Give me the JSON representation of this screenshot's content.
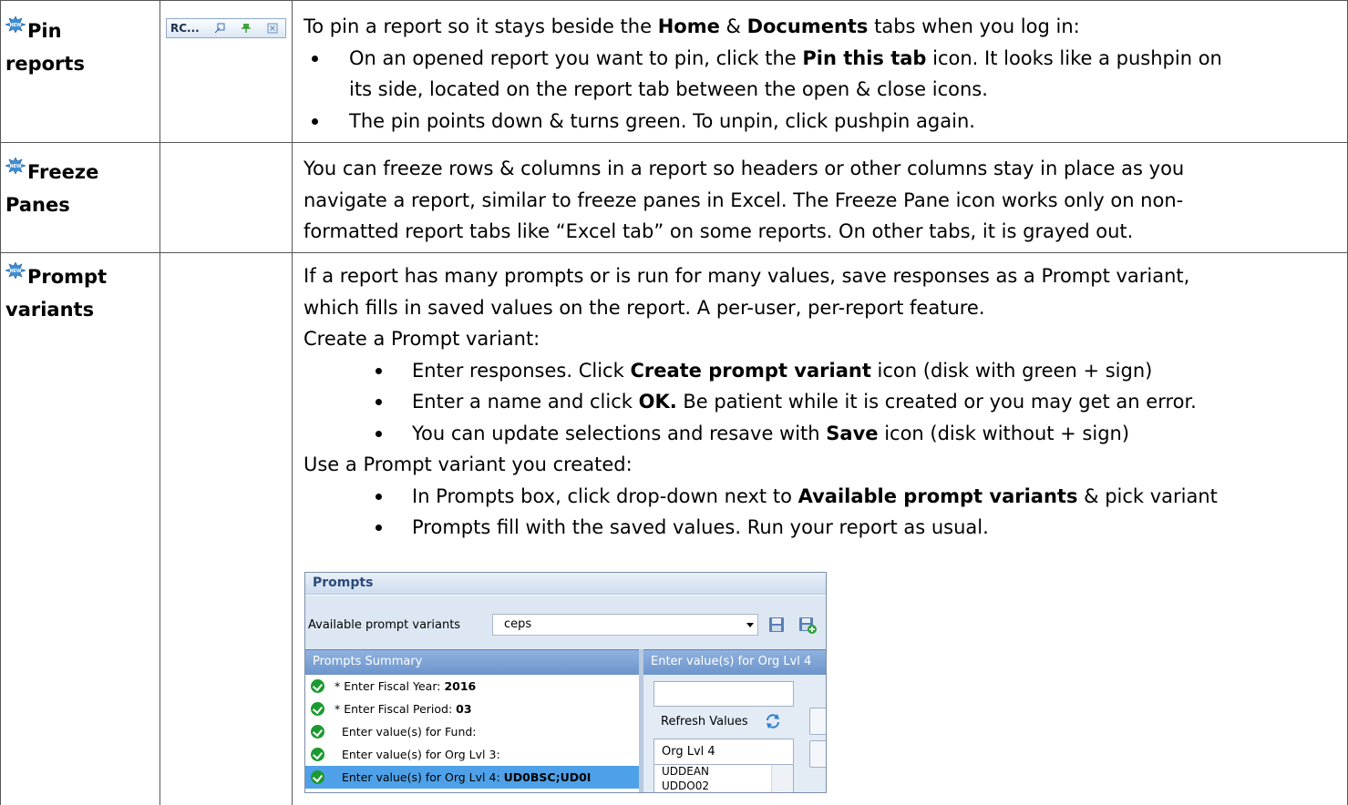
{
  "rows": [
    {
      "feature_line1": "Pin",
      "feature_line2": "reports",
      "tab_chip_label": "RC...",
      "intro": {
        "pre": "To pin a report so it stays beside the ",
        "b1": "Home",
        "mid": " & ",
        "b2": "Documents",
        "post": " tabs when you log in:"
      },
      "bullets": [
        {
          "pre": "On an opened report you want to pin, click the ",
          "bold": "Pin this tab",
          "post": " icon.  It looks like a pushpin on",
          "cont": "its side, located on the report tab between the open & close icons."
        },
        {
          "text": "The pin points down & turns green.  To unpin, click pushpin again."
        }
      ]
    },
    {
      "feature_line1": "Freeze",
      "feature_line2": "Panes",
      "lines": [
        "You can freeze rows & columns in a report so headers or other columns stay in place as you",
        "navigate a report, similar to freeze panes in Excel.  The Freeze Pane icon works only on non-",
        "formatted report tabs like “Excel tab” on some reports. On other tabs, it is grayed out."
      ]
    },
    {
      "feature_line1": "Prompt",
      "feature_line2": "variants",
      "intro_lines": [
        "If a report has many prompts or is run for many values, save responses as a Prompt variant,",
        "which fills in saved values on the report.  A per-user, per-report feature."
      ],
      "create_heading": "Create a Prompt variant:",
      "create_bullets": [
        {
          "pre": "Enter responses. Click ",
          "bold": "Create prompt variant",
          "post": " icon (disk with green + sign)"
        },
        {
          "pre": "Enter a name and click ",
          "bold": "OK.",
          "post": "  Be patient while it is created or you may get an error."
        },
        {
          "pre": "You can update selections and resave with ",
          "bold": "Save",
          "post": " icon (disk without + sign)"
        }
      ],
      "use_heading": "Use a Prompt variant you created:",
      "use_bullets": [
        {
          "pre": "In Prompts box, click drop-down next to ",
          "bold": "Available prompt variants",
          "post": " & pick variant"
        },
        {
          "pre": "Prompts fill with the saved values.  Run your report as usual.",
          "bold": "",
          "post": ""
        }
      ]
    }
  ],
  "screenshot": {
    "title": "Prompts",
    "variants_label": "Available prompt variants",
    "variants_value": "ceps",
    "summary_header": "Prompts Summary",
    "right_header": "Enter value(s) for Org Lvl 4",
    "prompt_rows": [
      {
        "label": "* Enter Fiscal Year: ",
        "value": "2016"
      },
      {
        "label": "* Enter Fiscal Period: ",
        "value": "03"
      },
      {
        "label": "  Enter value(s) for Fund:",
        "value": ""
      },
      {
        "label": "  Enter value(s) for Org Lvl 3:",
        "value": ""
      },
      {
        "label": "  Enter value(s) for Org Lvl 4: ",
        "value": "UD0BSC;UD0I"
      }
    ],
    "refresh_label": "Refresh Values",
    "list_header": "Org Lvl 4",
    "list_items": [
      "UDDEAN",
      "UDDO02"
    ]
  },
  "colors": {
    "green_check": "#1a9a2f",
    "header_blue": "#6d95cb",
    "selected_row": "#4ea1e8"
  }
}
